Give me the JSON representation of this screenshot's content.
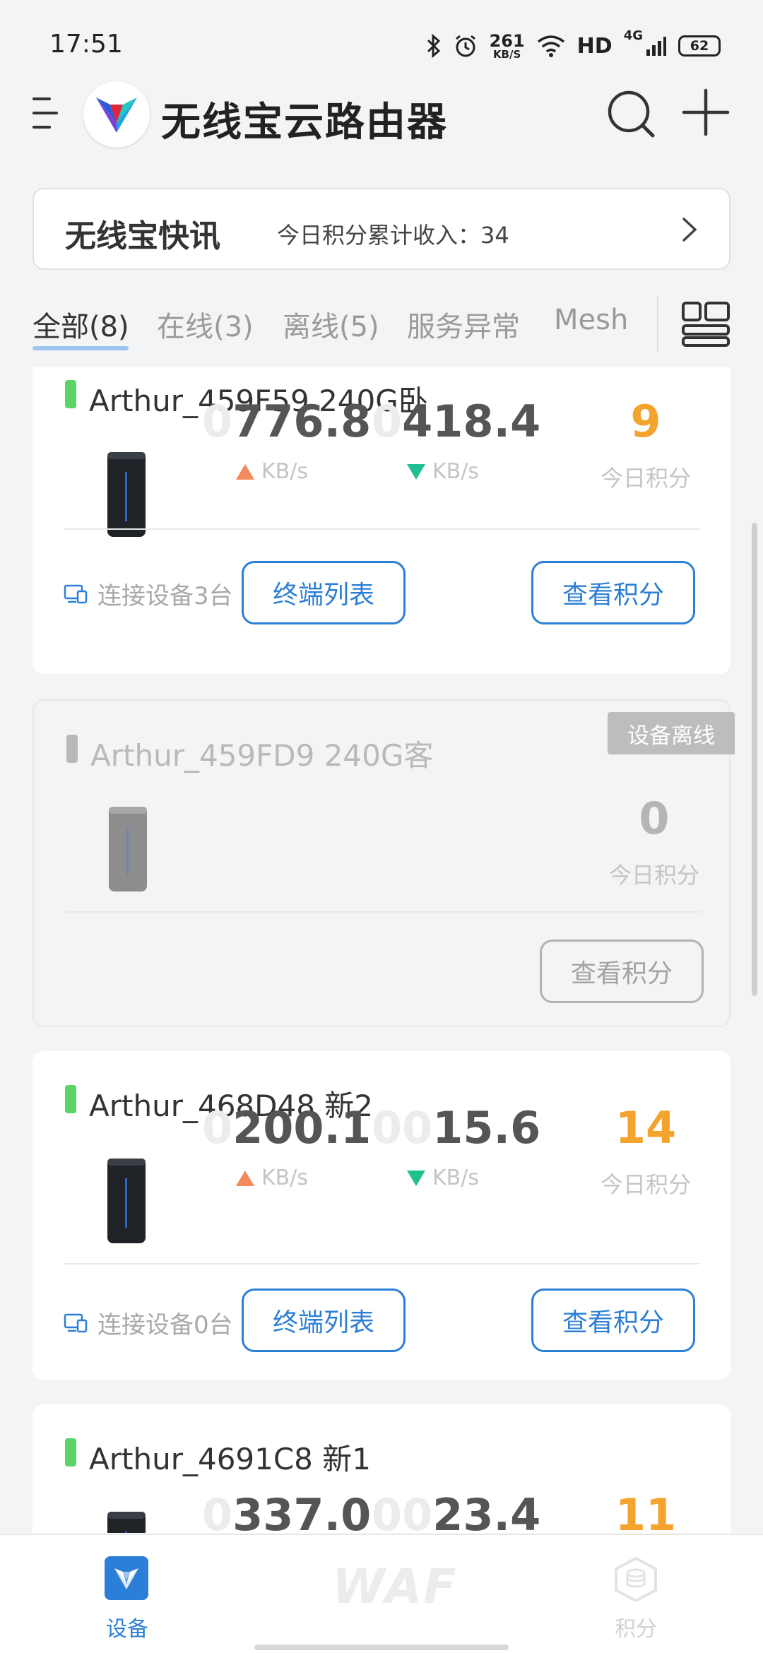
{
  "status_bar": {
    "time": "17:51",
    "net_speed_value": "261",
    "net_speed_unit": "KB/S",
    "hd": "HD",
    "signal": "4G",
    "battery": "62"
  },
  "header": {
    "title": "无线宝云路由器"
  },
  "news": {
    "title": "无线宝快讯",
    "text": "今日积分累计收入：34"
  },
  "tabs": [
    {
      "label": "全部(8)",
      "active": true
    },
    {
      "label": "在线(3)",
      "active": false
    },
    {
      "label": "离线(5)",
      "active": false
    },
    {
      "label": "服务异常",
      "active": false
    },
    {
      "label": "Mesh",
      "active": false
    }
  ],
  "devices": [
    {
      "name": "Arthur_459F59 240G卧",
      "online": true,
      "up_lead": "0",
      "up_value": "776.8",
      "down_lead": "0",
      "down_value": "418.4",
      "unit": "KB/s",
      "points": "9",
      "points_label": "今日积分",
      "connected": "连接设备3台",
      "terminal_button": "终端列表",
      "points_button": "查看积分"
    },
    {
      "name": "Arthur_459FD9 240G客",
      "online": false,
      "offline_badge": "设备离线",
      "points": "0",
      "points_label": "今日积分",
      "points_button": "查看积分"
    },
    {
      "name": "Arthur_468D48 新2",
      "online": true,
      "up_lead": "0",
      "up_value": "200.1",
      "down_lead": "00",
      "down_value": "15.6",
      "unit": "KB/s",
      "points": "14",
      "points_label": "今日积分",
      "connected": "连接设备0台",
      "terminal_button": "终端列表",
      "points_button": "查看积分"
    },
    {
      "name": "Arthur_4691C8 新1",
      "online": true,
      "up_lead": "0",
      "up_value": "337.0",
      "down_lead": "00",
      "down_value": "23.4",
      "points": "11"
    }
  ],
  "bottom_nav": {
    "device_label": "设备",
    "waf_text": "WAF",
    "points_label": "积分"
  },
  "colors": {
    "accent": "#2c7fd6",
    "points": "#f4a32c",
    "online": "#5bd468",
    "upload": "#f28a5b",
    "download": "#1fbf8f"
  }
}
